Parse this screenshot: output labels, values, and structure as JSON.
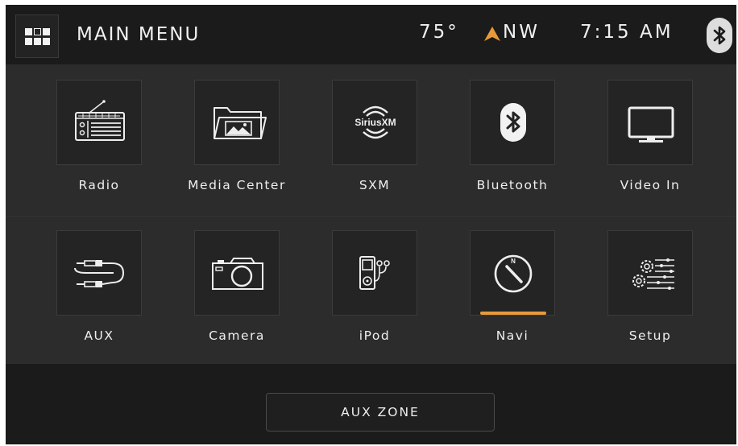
{
  "header": {
    "title": "MAIN MENU",
    "temperature": "75°",
    "heading": "NW",
    "time": "7:15 AM",
    "menu_icon": "grid-menu-icon",
    "status_icon": "bluetooth-icon",
    "accent_color": "#e89a3a"
  },
  "tiles": [
    {
      "label": "Radio",
      "icon": "radio-icon",
      "active": false
    },
    {
      "label": "Media Center",
      "icon": "folder-image-icon",
      "active": false
    },
    {
      "label": "SXM",
      "icon": "siriusxm-logo-icon",
      "logo_text": "SiriusXM",
      "active": false
    },
    {
      "label": "Bluetooth",
      "icon": "bluetooth-icon",
      "active": false
    },
    {
      "label": "Video In",
      "icon": "monitor-icon",
      "active": false
    },
    {
      "label": "AUX",
      "icon": "aux-cable-icon",
      "active": false
    },
    {
      "label": "Camera",
      "icon": "camera-icon",
      "active": false
    },
    {
      "label": "iPod",
      "icon": "ipod-earbuds-icon",
      "active": false
    },
    {
      "label": "Navi",
      "icon": "compass-icon",
      "compass_letter": "N",
      "active": true
    },
    {
      "label": "Setup",
      "icon": "settings-gears-icon",
      "active": false
    }
  ],
  "footer": {
    "aux_zone_label": "AUX ZONE"
  }
}
